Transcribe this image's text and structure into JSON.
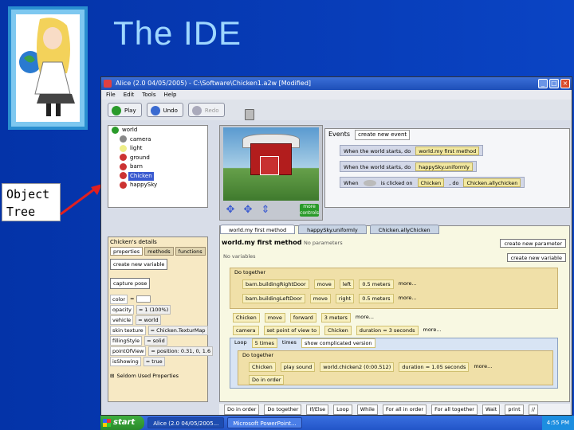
{
  "slide": {
    "title": "The IDE",
    "callout": "Object Tree"
  },
  "window": {
    "title": "Alice (2.0 04/05/2005) - C:\\Software\\Chicken1.a2w [Modified]",
    "menu": [
      "File",
      "Edit",
      "Tools",
      "Help"
    ],
    "toolbar": {
      "play": "Play",
      "undo": "Undo",
      "redo": "Redo"
    }
  },
  "tree": {
    "items": [
      "world",
      "camera",
      "light",
      "ground",
      "barn",
      "Chicken",
      "happySky"
    ],
    "selected": "Chicken"
  },
  "scene": {
    "more_controls": "more controls"
  },
  "events": {
    "header": "Events",
    "create_button": "create new event",
    "rows": [
      {
        "when": "When the world starts, do",
        "action": "world.my first method"
      },
      {
        "when": "When the world starts, do",
        "action": "happySky.uniformly"
      },
      {
        "when": "When",
        "middle": "is clicked on",
        "target": "Chicken",
        "do": ", do",
        "action": "Chicken.allychicken"
      }
    ]
  },
  "details": {
    "title": "Chicken's details",
    "tabs": [
      "properties",
      "methods",
      "functions"
    ],
    "create_var": "create new variable",
    "capture_pose": "capture pose",
    "properties": [
      {
        "name": "color",
        "value": "="
      },
      {
        "name": "opacity",
        "value": "= 1 (100%)"
      },
      {
        "name": "vehicle",
        "value": "= world"
      },
      {
        "name": "skin texture",
        "value": "= Chicken.TexturMap"
      },
      {
        "name": "fillingStyle",
        "value": "= solid"
      },
      {
        "name": "pointOfView",
        "value": "= position: 0.31, 0, 1.6"
      },
      {
        "name": "isShowing",
        "value": "= true"
      }
    ],
    "seldom": "Seldom Used Properties"
  },
  "editor": {
    "tabs": [
      "world.my first method",
      "happySky.uniformly",
      "Chicken.allyChicken"
    ],
    "method_header": "world.my first method",
    "no_params": "No parameters",
    "no_vars": "No variables",
    "create_param": "create new parameter",
    "create_var": "create new variable",
    "lines": [
      {
        "text": "Do together"
      },
      {
        "obj": "barn.buildingRightDoor",
        "verb": "move",
        "dir": "left",
        "amt": "0.5 meters",
        "more": "more..."
      },
      {
        "obj": "barn.buildingLeftDoor",
        "verb": "move",
        "dir": "right",
        "amt": "0.5 meters",
        "more": "more..."
      },
      {
        "obj": "Chicken",
        "verb": "move",
        "dir": "forward",
        "amt": "3 meters",
        "more": "more..."
      },
      {
        "obj": "camera",
        "verb": "set point of view to",
        "dir": "Chicken",
        "amt": "duration = 3 seconds",
        "more": "more..."
      },
      {
        "loop": "Loop",
        "times": "5 times",
        "label": "times",
        "complicated": "show complicated version"
      },
      {
        "text": "Do together"
      },
      {
        "obj": "Chicken",
        "verb": "play sound",
        "dir": "world.chicken2 (0:00.512)",
        "amt": "duration = 1.05 seconds",
        "more": "more..."
      },
      {
        "text": "Do in order"
      }
    ],
    "bottom": [
      "Do in order",
      "Do together",
      "If/Else",
      "Loop",
      "While",
      "For all in order",
      "For all together",
      "Wait",
      "print",
      "//"
    ]
  },
  "taskbar": {
    "start": "start",
    "tasks": [
      "Alice (2.0 04/05/2005...",
      "Microsoft PowerPoint..."
    ],
    "clock": "4:55 PM"
  },
  "colors": {
    "slide_bg": "#0a44c4",
    "title_text": "#9fd7ff",
    "editor_bg": "#f8f8e2",
    "details_bg": "#f7e9c4"
  }
}
